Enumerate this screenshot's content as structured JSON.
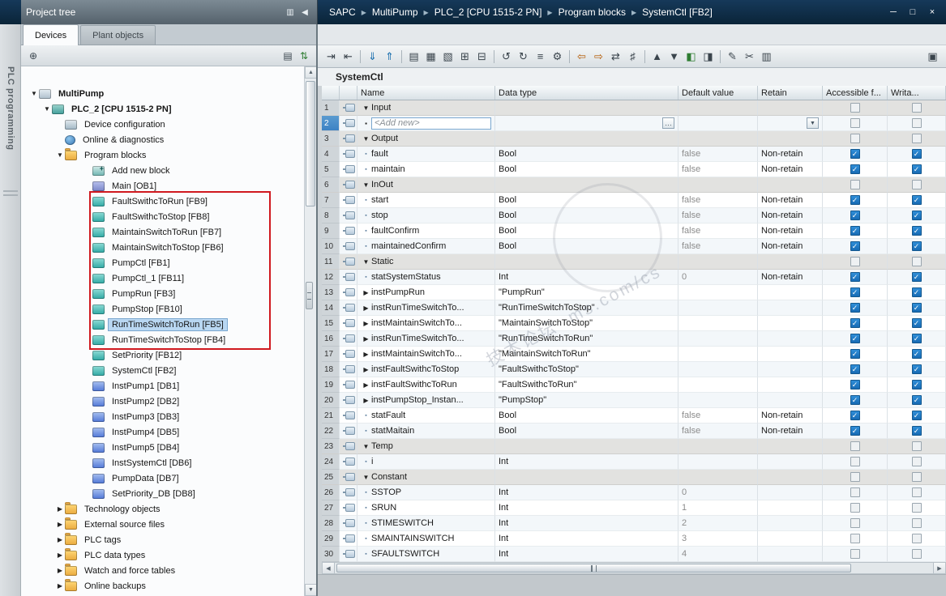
{
  "titlebar": {
    "breadcrumb": [
      "SAPC",
      "MultiPump",
      "PLC_2 [CPU 1515-2 PN]",
      "Program blocks",
      "SystemCtl [FB2]"
    ],
    "window_controls": [
      {
        "glyph": "─",
        "name": "minimize-button"
      },
      {
        "glyph": "□",
        "name": "restore-down-button"
      },
      {
        "glyph": "×",
        "name": "close-button"
      }
    ]
  },
  "side_strip": {
    "label": "PLC programming"
  },
  "project_tree": {
    "title": "Project tree",
    "header_icons": [
      {
        "glyph": "▥",
        "name": "panel-options-icon"
      },
      {
        "glyph": "◀",
        "name": "collapse-panel-icon"
      }
    ],
    "tabs": [
      {
        "label": "Devices",
        "active": true
      },
      {
        "label": "Plant objects",
        "active": false
      }
    ],
    "toolbar": [
      {
        "glyph": "⊕",
        "name": "new-item-icon"
      },
      {
        "glyph": "▤",
        "name": "details-view-icon",
        "right": true
      },
      {
        "glyph": "⇅",
        "name": "sort-order-icon",
        "color": "#2e7d32"
      }
    ],
    "items": [
      {
        "depth": 1,
        "icon": "project",
        "label": "MultiPump",
        "expander": "open",
        "bold": true
      },
      {
        "depth": 2,
        "icon": "plc",
        "label": "PLC_2 [CPU 1515-2 PN]",
        "expander": "open",
        "bold": true
      },
      {
        "depth": 3,
        "icon": "device-config",
        "label": "Device configuration"
      },
      {
        "depth": 3,
        "icon": "online-diag",
        "label": "Online & diagnostics"
      },
      {
        "depth": 3,
        "icon": "folder-blocks",
        "label": "Program blocks",
        "expander": "open"
      },
      {
        "depth": 4,
        "icon": "add-block",
        "label": "Add new block"
      },
      {
        "depth": 4,
        "icon": "ob",
        "label": "Main [OB1]"
      },
      {
        "depth": 4,
        "icon": "fb",
        "label": "FaultSwithcToRun [FB9]"
      },
      {
        "depth": 4,
        "icon": "fb",
        "label": "FaultSwithcToStop [FB8]"
      },
      {
        "depth": 4,
        "icon": "fb",
        "label": "MaintainSwitchToRun [FB7]"
      },
      {
        "depth": 4,
        "icon": "fb",
        "label": "MaintainSwitchToStop [FB6]"
      },
      {
        "depth": 4,
        "icon": "fb",
        "label": "PumpCtl [FB1]"
      },
      {
        "depth": 4,
        "icon": "fb",
        "label": "PumpCtl_1 [FB11]"
      },
      {
        "depth": 4,
        "icon": "fb",
        "label": "PumpRun [FB3]"
      },
      {
        "depth": 4,
        "icon": "fb",
        "label": "PumpStop [FB10]"
      },
      {
        "depth": 4,
        "icon": "fb",
        "label": "RunTimeSwitchToRun [FB5]",
        "selected": true
      },
      {
        "depth": 4,
        "icon": "fb",
        "label": "RunTimeSwitchToStop [FB4]"
      },
      {
        "depth": 4,
        "icon": "fb",
        "label": "SetPriority [FB12]"
      },
      {
        "depth": 4,
        "icon": "fb",
        "label": "SystemCtl [FB2]"
      },
      {
        "depth": 4,
        "icon": "db",
        "label": "InstPump1 [DB1]"
      },
      {
        "depth": 4,
        "icon": "db",
        "label": "InstPump2 [DB2]"
      },
      {
        "depth": 4,
        "icon": "db",
        "label": "InstPump3 [DB3]"
      },
      {
        "depth": 4,
        "icon": "db",
        "label": "InstPump4 [DB5]"
      },
      {
        "depth": 4,
        "icon": "db",
        "label": "InstPump5 [DB4]"
      },
      {
        "depth": 4,
        "icon": "db",
        "label": "InstSystemCtl [DB6]"
      },
      {
        "depth": 4,
        "icon": "db",
        "label": "PumpData [DB7]"
      },
      {
        "depth": 4,
        "icon": "db",
        "label": "SetPriority_DB [DB8]"
      },
      {
        "depth": 3,
        "icon": "folder-tech",
        "label": "Technology objects",
        "expander": "closed"
      },
      {
        "depth": 3,
        "icon": "folder-src",
        "label": "External source files",
        "expander": "closed"
      },
      {
        "depth": 3,
        "icon": "folder-tags",
        "label": "PLC tags",
        "expander": "closed"
      },
      {
        "depth": 3,
        "icon": "folder-udt",
        "label": "PLC data types",
        "expander": "closed"
      },
      {
        "depth": 3,
        "icon": "folder-watch",
        "label": "Watch and force tables",
        "expander": "closed"
      },
      {
        "depth": 3,
        "icon": "folder-backup",
        "label": "Online backups",
        "expander": "closed"
      }
    ]
  },
  "editor": {
    "block_title": "SystemCtl",
    "toolbar": [
      {
        "glyph": "⇥",
        "name": "insert-row-icon"
      },
      {
        "glyph": "⇤",
        "name": "add-row-icon"
      },
      {
        "sep": true
      },
      {
        "glyph": "⇓",
        "name": "load-values-icon",
        "color": "#1b6fae"
      },
      {
        "glyph": "⇑",
        "name": "upload-values-icon",
        "color": "#1b6fae"
      },
      {
        "sep": true
      },
      {
        "glyph": "▤",
        "name": "keep-actual-values-icon"
      },
      {
        "glyph": "▦",
        "name": "snapshot-icon"
      },
      {
        "glyph": "▧",
        "name": "copy-snapshot-icon"
      },
      {
        "glyph": "⊞",
        "name": "expand-all-icon"
      },
      {
        "glyph": "⊟",
        "name": "collapse-all-icon"
      },
      {
        "sep": true
      },
      {
        "glyph": "↺",
        "name": "undo-icon"
      },
      {
        "glyph": "↻",
        "name": "redo-icon"
      },
      {
        "glyph": "≡",
        "name": "row-display-icon"
      },
      {
        "glyph": "⚙",
        "name": "compile-icon"
      },
      {
        "sep": true
      },
      {
        "glyph": "⇦",
        "name": "go-offline-icon",
        "color": "#b35900"
      },
      {
        "glyph": "⇨",
        "name": "go-online-icon",
        "color": "#b35900"
      },
      {
        "glyph": "⇄",
        "name": "sync-icon"
      },
      {
        "glyph": "♯",
        "name": "absolute-operands-icon"
      },
      {
        "sep": true
      },
      {
        "glyph": "▲",
        "name": "insert-network-icon"
      },
      {
        "glyph": "▼",
        "name": "delete-network-icon"
      },
      {
        "glyph": "◧",
        "name": "monitor-icon",
        "color": "#2e7d32"
      },
      {
        "glyph": "◨",
        "name": "modify-icon"
      },
      {
        "sep": true
      },
      {
        "glyph": "✎",
        "name": "edit-icon"
      },
      {
        "glyph": "✂",
        "name": "cut-icon"
      },
      {
        "glyph": "▥",
        "name": "paste-icon"
      },
      {
        "glyph": "▣",
        "name": "maximize-editor-icon",
        "right": true
      }
    ],
    "watermark": {
      "text1": "技术论坛",
      "text2": "ms.com/cs"
    },
    "table": {
      "columns": [
        "Name",
        "Data type",
        "Default value",
        "Retain",
        "Accessible f...",
        "Writa..."
      ],
      "rows": [
        {
          "n": 1,
          "kind": "section",
          "name": "Input"
        },
        {
          "n": 2,
          "kind": "addnew",
          "name": "<Add new>",
          "cursor": true
        },
        {
          "n": 3,
          "kind": "section",
          "name": "Output"
        },
        {
          "n": 4,
          "kind": "var",
          "name": "fault",
          "dt": "Bool",
          "def": "false",
          "retain": "Non-retain",
          "acc": true,
          "wr": true
        },
        {
          "n": 5,
          "kind": "var",
          "name": "maintain",
          "dt": "Bool",
          "def": "false",
          "retain": "Non-retain",
          "acc": true,
          "wr": true
        },
        {
          "n": 6,
          "kind": "section",
          "name": "InOut"
        },
        {
          "n": 7,
          "kind": "var",
          "name": "start",
          "dt": "Bool",
          "def": "false",
          "retain": "Non-retain",
          "acc": true,
          "wr": true
        },
        {
          "n": 8,
          "kind": "var",
          "name": "stop",
          "dt": "Bool",
          "def": "false",
          "retain": "Non-retain",
          "acc": true,
          "wr": true
        },
        {
          "n": 9,
          "kind": "var",
          "name": "faultConfirm",
          "dt": "Bool",
          "def": "false",
          "retain": "Non-retain",
          "acc": true,
          "wr": true
        },
        {
          "n": 10,
          "kind": "var",
          "name": "maintainedConfirm",
          "dt": "Bool",
          "def": "false",
          "retain": "Non-retain",
          "acc": true,
          "wr": true
        },
        {
          "n": 11,
          "kind": "section",
          "name": "Static"
        },
        {
          "n": 12,
          "kind": "var",
          "name": "statSystemStatus",
          "dt": "Int",
          "def": "0",
          "retain": "Non-retain",
          "acc": true,
          "wr": true
        },
        {
          "n": 13,
          "kind": "inst",
          "name": "instPumpRun",
          "dt": "\"PumpRun\"",
          "acc": true,
          "wr": true
        },
        {
          "n": 14,
          "kind": "inst",
          "name": "instRunTimeSwitchTo...",
          "dt": "\"RunTimeSwitchToStop\"",
          "acc": true,
          "wr": true
        },
        {
          "n": 15,
          "kind": "inst",
          "name": "instMaintainSwitchTo...",
          "dt": "\"MaintainSwitchToStop\"",
          "acc": true,
          "wr": true
        },
        {
          "n": 16,
          "kind": "inst",
          "name": "instRunTimeSwitchTo...",
          "dt": "\"RunTimeSwitchToRun\"",
          "acc": true,
          "wr": true
        },
        {
          "n": 17,
          "kind": "inst",
          "name": "instMaintainSwitchTo...",
          "dt": "\"MaintainSwitchToRun\"",
          "acc": true,
          "wr": true
        },
        {
          "n": 18,
          "kind": "inst",
          "name": "instFaultSwithcToStop",
          "dt": "\"FaultSwithcToStop\"",
          "acc": true,
          "wr": true
        },
        {
          "n": 19,
          "kind": "inst",
          "name": "instFaultSwithcToRun",
          "dt": "\"FaultSwithcToRun\"",
          "acc": true,
          "wr": true
        },
        {
          "n": 20,
          "kind": "inst",
          "name": "instPumpStop_Instan...",
          "dt": "\"PumpStop\"",
          "acc": true,
          "wr": true
        },
        {
          "n": 21,
          "kind": "var",
          "name": "statFault",
          "dt": "Bool",
          "def": "false",
          "retain": "Non-retain",
          "acc": true,
          "wr": true
        },
        {
          "n": 22,
          "kind": "var",
          "name": "statMaitain",
          "dt": "Bool",
          "def": "false",
          "retain": "Non-retain",
          "acc": true,
          "wr": true
        },
        {
          "n": 23,
          "kind": "section",
          "name": "Temp"
        },
        {
          "n": 24,
          "kind": "var",
          "name": "i",
          "dt": "Int"
        },
        {
          "n": 25,
          "kind": "section",
          "name": "Constant"
        },
        {
          "n": 26,
          "kind": "var",
          "name": "SSTOP",
          "dt": "Int",
          "def": "0"
        },
        {
          "n": 27,
          "kind": "var",
          "name": "SRUN",
          "dt": "Int",
          "def": "1"
        },
        {
          "n": 28,
          "kind": "var",
          "name": "STIMESWITCH",
          "dt": "Int",
          "def": "2"
        },
        {
          "n": 29,
          "kind": "var",
          "name": "SMAINTAINSWITCH",
          "dt": "Int",
          "def": "3"
        },
        {
          "n": 30,
          "kind": "var",
          "name": "SFAULTSWITCH",
          "dt": "Int",
          "def": "4"
        }
      ]
    }
  },
  "colors": {
    "titlebar": "#0c2a44",
    "checkbox_checked": "#1872b8",
    "selection": "#b9d7f2",
    "red_highlight": "#d0191f",
    "fb_icon": "#2fa8a4",
    "db_icon": "#5077d6",
    "folder_icon": "#e9a93d"
  }
}
